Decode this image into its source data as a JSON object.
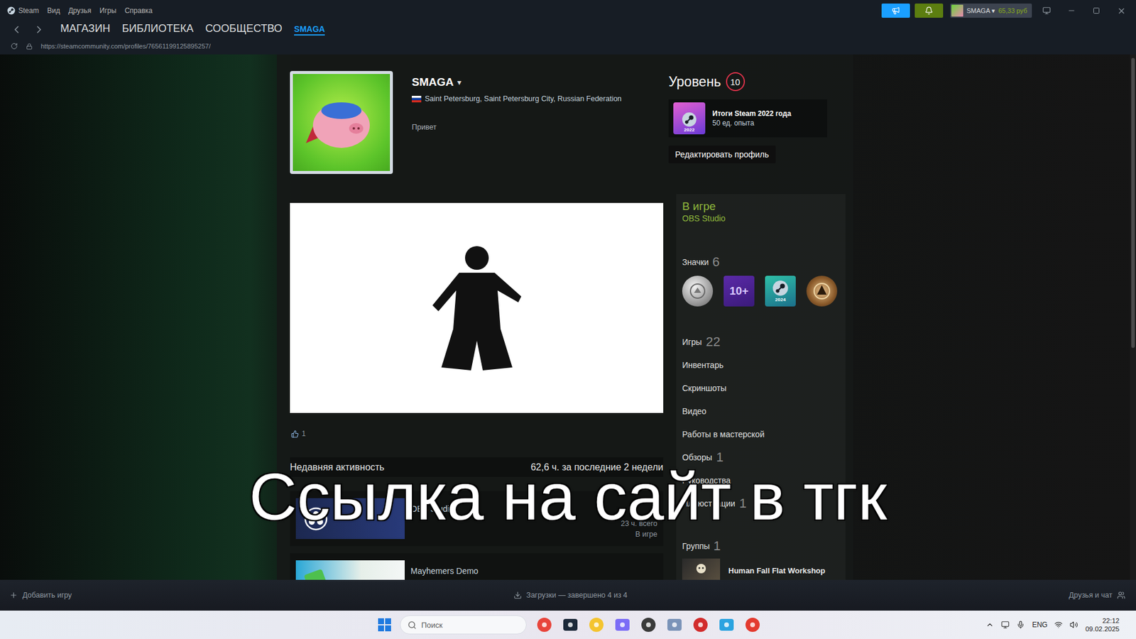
{
  "window": {
    "title": "Steam",
    "menu": [
      "Вид",
      "Друзья",
      "Игры",
      "Справка"
    ]
  },
  "account": {
    "name": "SMAGA",
    "caret": "▾",
    "balance": "65,33 руб"
  },
  "nav": {
    "items": [
      {
        "label": "МАГАЗИН",
        "selected": false
      },
      {
        "label": "БИБЛИОТЕКА",
        "selected": false
      },
      {
        "label": "СООБЩЕСТВО",
        "selected": false
      },
      {
        "label": "SMAGA",
        "selected": true
      }
    ],
    "url": "https://steamcommunity.com/profiles/76561199125895257/"
  },
  "profile": {
    "name": "SMAGA",
    "caret": "▾",
    "location": "Saint Petersburg, Saint Petersburg City, Russian Federation",
    "summary": "Привет",
    "level_label": "Уровень",
    "level": "10",
    "featured_badge": {
      "year": "2022",
      "title": "Итоги Steam 2022 года",
      "xp": "50 ед. опыта"
    },
    "edit_button": "Редактировать профиль"
  },
  "showcase": {
    "likes": "1"
  },
  "recent_activity": {
    "title": "Недавняя активность",
    "hours": "62,6 ч. за последние 2 недели",
    "games": [
      {
        "name": "OBS Studio",
        "total": "23 ч. всего",
        "status": "В игре",
        "kind": "obs"
      },
      {
        "name": "Mayhemers Demo",
        "kind": "mayhemers"
      }
    ]
  },
  "sidebar": {
    "status": "В игре",
    "game": "OBS Studio",
    "badges": {
      "label": "Значки",
      "count": "6",
      "items": [
        {
          "kind": "coin"
        },
        {
          "kind": "years",
          "text": "10+"
        },
        {
          "kind": "steam",
          "text": "2024"
        },
        {
          "kind": "emblem"
        }
      ]
    },
    "links": [
      {
        "label": "Игры",
        "count": "22"
      },
      {
        "label": "Инвентарь"
      },
      {
        "label": "Скриншоты"
      },
      {
        "label": "Видео"
      },
      {
        "label": "Работы в мастерской"
      },
      {
        "label": "Обзоры",
        "count": "1"
      },
      {
        "label": "Руководства"
      },
      {
        "label": "Иллюстрации",
        "count": "1"
      }
    ],
    "groups": {
      "label": "Группы",
      "count": "1",
      "items": [
        {
          "name": "Human Fall Flat Workshop"
        }
      ]
    }
  },
  "subtitle": "Ссылка на сайт в тгк",
  "bottom_bar": {
    "add_game": "Добавить игру",
    "downloads": "Загрузки — завершено 4 из 4",
    "friends": "Друзья и чат"
  },
  "taskbar": {
    "search_placeholder": "Поиск",
    "language": "ENG",
    "time": "22:12",
    "date": "09.02.2025"
  }
}
